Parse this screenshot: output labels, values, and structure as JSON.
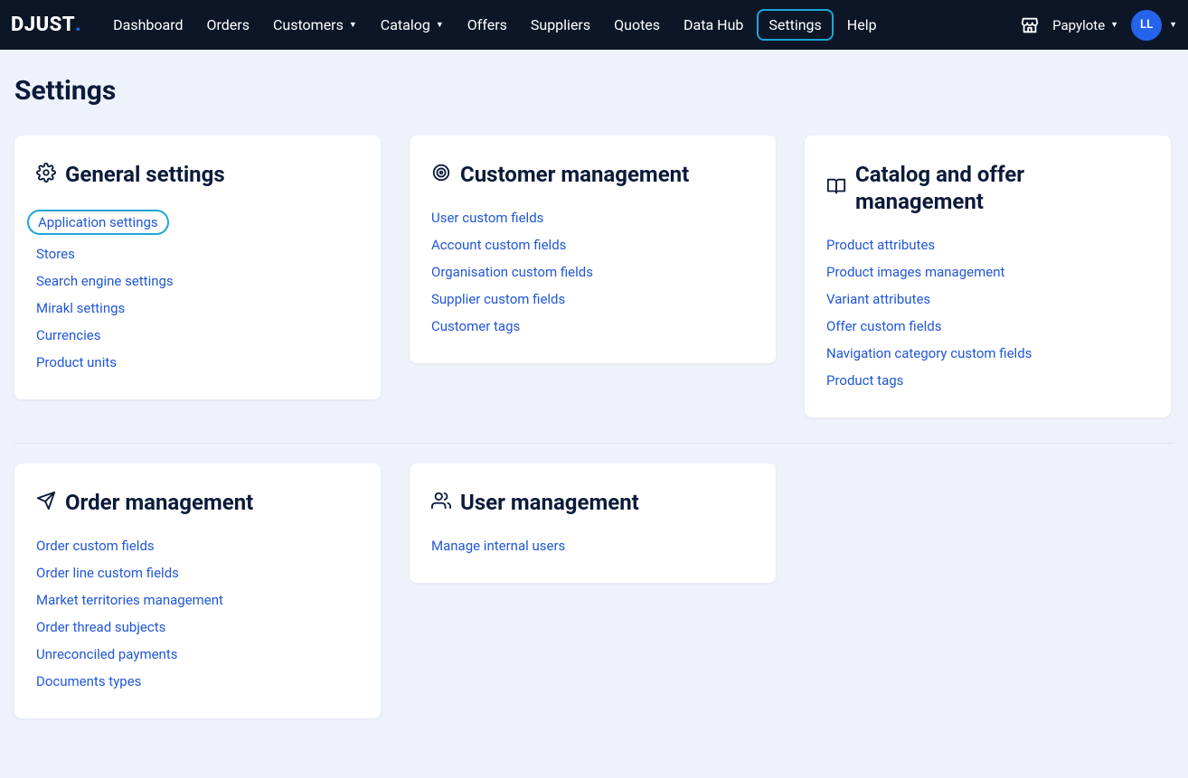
{
  "brand": "DJUST",
  "nav": [
    {
      "label": "Dashboard",
      "dropdown": false,
      "active": false
    },
    {
      "label": "Orders",
      "dropdown": false,
      "active": false
    },
    {
      "label": "Customers",
      "dropdown": true,
      "active": false
    },
    {
      "label": "Catalog",
      "dropdown": true,
      "active": false
    },
    {
      "label": "Offers",
      "dropdown": false,
      "active": false
    },
    {
      "label": "Suppliers",
      "dropdown": false,
      "active": false
    },
    {
      "label": "Quotes",
      "dropdown": false,
      "active": false
    },
    {
      "label": "Data Hub",
      "dropdown": false,
      "active": false
    },
    {
      "label": "Settings",
      "dropdown": false,
      "active": true
    },
    {
      "label": "Help",
      "dropdown": false,
      "active": false
    }
  ],
  "org": {
    "name": "Papylote"
  },
  "user": {
    "initials": "LL"
  },
  "page": {
    "title": "Settings"
  },
  "sections": {
    "general": {
      "title": "General settings",
      "links": [
        "Application settings",
        "Stores",
        "Search engine settings",
        "Mirakl settings",
        "Currencies",
        "Product units"
      ],
      "highlight_index": 0
    },
    "customer": {
      "title": "Customer management",
      "links": [
        "User custom fields",
        "Account custom fields",
        "Organisation custom fields",
        "Supplier custom fields",
        "Customer tags"
      ]
    },
    "catalog": {
      "title": "Catalog and offer management",
      "links": [
        "Product attributes",
        "Product images management",
        "Variant attributes",
        "Offer custom fields",
        "Navigation category custom fields",
        "Product tags"
      ]
    },
    "order": {
      "title": "Order management",
      "links": [
        "Order custom fields",
        "Order line custom fields",
        "Market territories management",
        "Order thread subjects",
        "Unreconciled payments",
        "Documents types"
      ]
    },
    "usermgmt": {
      "title": "User management",
      "links": [
        "Manage internal users"
      ]
    }
  }
}
